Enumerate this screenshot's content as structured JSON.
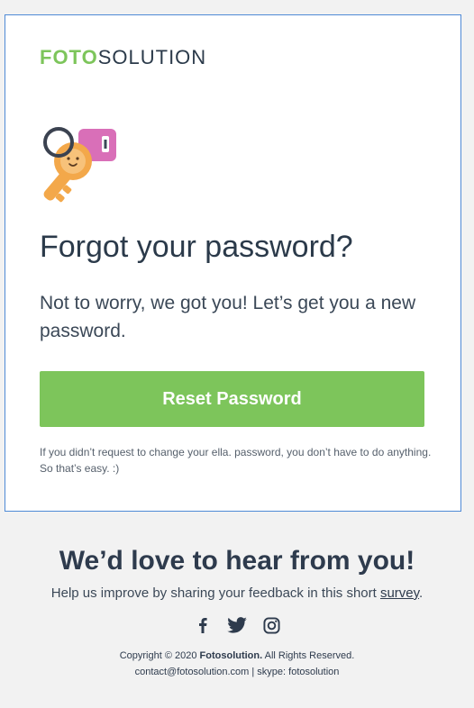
{
  "logo": {
    "part1": "FOTO",
    "part2": "SOLUTION",
    "part1_color": "#7dc55b",
    "part2_color": "#2b3a4a"
  },
  "hero": {
    "icon": "key-icon"
  },
  "title": "Forgot your password?",
  "subtitle": "Not to worry, we got you! Let’s get you a new password.",
  "button": {
    "label": "Reset Password",
    "color": "#7dc55b"
  },
  "footnote": "If you didn’t request to change your ella. password, you don’t have to do anything. So that’s easy. :)",
  "footer": {
    "heading": "We’d love to hear from you!",
    "subtext_prefix": "Help us improve by sharing your feedback in this short ",
    "survey_link": "survey",
    "subtext_suffix": ".",
    "social": [
      {
        "name": "facebook-icon"
      },
      {
        "name": "twitter-icon"
      },
      {
        "name": "instagram-icon"
      }
    ],
    "copyright_prefix": "Copyright © 2020 ",
    "company": "Fotosolution.",
    "copyright_suffix": " All Rights Reserved.",
    "email": "contact@fotosolution.com",
    "separator": " | ",
    "skype": "skype: fotosolution"
  },
  "colors": {
    "accent": "#7dc55b",
    "card_border": "#4f8ad6",
    "text_dark": "#2b3a4a",
    "background": "#f2f2f2"
  }
}
